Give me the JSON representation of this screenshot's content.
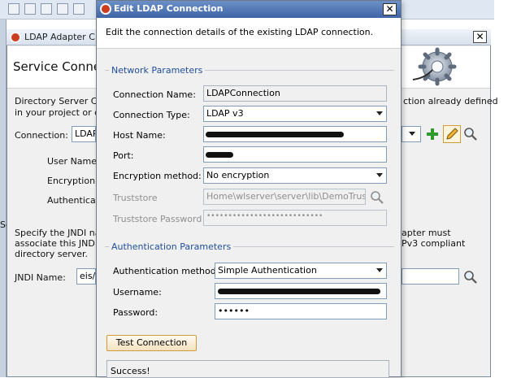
{
  "background_window": {
    "title": "LDAP Adapter C",
    "heading": "Service Conne",
    "description_line1": "Directory Server Con",
    "description_line2": "in your project or cre",
    "description_right": "ction already defined",
    "connection_label": "Connection:",
    "connection_value": "LDAP",
    "user_name_label": "User Name:",
    "encryption_label": "Encryption M",
    "authentication_label": "Authenticati",
    "jndi_help_line1": "Specify the JNDI nar",
    "jndi_help_line2": "associate this JNDI r",
    "jndi_help_line3": "directory server.",
    "jndi_help_right1": "apter must",
    "jndi_help_right2": "Pv3 compliant",
    "jndi_name_label": "JNDI Name:",
    "jndi_name_value": "eis/l",
    "left_cut_text": "Sc"
  },
  "dialog": {
    "title": "Edit LDAP Connection",
    "close_symbol": "✕",
    "description": "Edit the connection details of the existing LDAP connection.",
    "network_section": "Network Parameters",
    "connection_name_label": "Connection Name:",
    "connection_name_value": "LDAPConnection",
    "connection_type_label": "Connection Type:",
    "connection_type_value": "LDAP v3",
    "host_name_label": "Host Name:",
    "port_label": "Port:",
    "encryption_label": "Encryption method:",
    "encryption_value": "No encryption",
    "truststore_label": "Truststore",
    "truststore_value": "Home\\wlserver\\server\\lib\\DemoTrust.jks",
    "truststore_password_label": "Truststore Password",
    "truststore_password_value": "•••••••••••••••••••••••••••",
    "auth_section": "Authentication Parameters",
    "auth_method_label": "Authentication method:",
    "auth_method_value": "Simple Authentication",
    "username_label": "Username:",
    "password_label": "Password:",
    "password_value": "••••••",
    "test_button": "Test Connection",
    "result_text": "Success!"
  },
  "colors": {
    "section_title": "#1f4e9c",
    "dialog_title_bar": "#3f64a6",
    "add_icon": "#2e9a2e",
    "button_border": "#d29a3a"
  },
  "icons": [
    "app-logo-icon",
    "close-icon",
    "gear-graphic-icon",
    "add-icon",
    "edit-pencil-icon",
    "search-icon",
    "dropdown-chevron-icon"
  ]
}
